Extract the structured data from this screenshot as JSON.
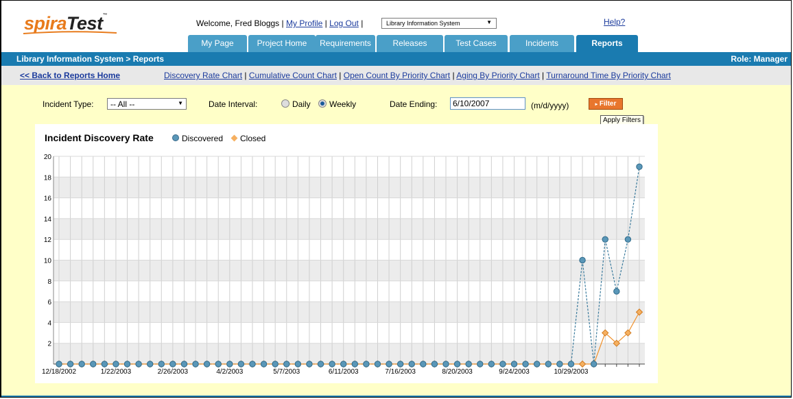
{
  "header": {
    "welcome": "Welcome, Fred Bloggs",
    "sep": "|",
    "my_profile": "My Profile",
    "log_out": "Log Out",
    "project": "Library Information System",
    "help": "Help?"
  },
  "tabs": [
    {
      "label": "My Page"
    },
    {
      "label": "Project Home"
    },
    {
      "label": "Requirements"
    },
    {
      "label": "Releases"
    },
    {
      "label": "Test Cases"
    },
    {
      "label": "Incidents"
    },
    {
      "label": "Reports",
      "active": true
    }
  ],
  "navbar": {
    "breadcrumb": "Library Information System > Reports",
    "role": "Role: Manager"
  },
  "subnav": {
    "back": "<< Back to Reports Home",
    "links": [
      "Discovery Rate Chart",
      "Cumulative Count Chart",
      "Open Count By Priority Chart",
      "Aging By Priority Chart",
      "Turnaround Time By Priority Chart"
    ]
  },
  "filters": {
    "incident_type_label": "Incident Type:",
    "incident_type_value": "-- All --",
    "date_interval_label": "Date Interval:",
    "daily": "Daily",
    "weekly": "Weekly",
    "interval_selected": "weekly",
    "date_ending_label": "Date Ending:",
    "date_ending_value": "6/10/2007",
    "date_format": "(m/d/yyyy)",
    "filter_button": "Filter",
    "tooltip": "Apply Filters"
  },
  "colors": {
    "brand_orange": "#e87b1c",
    "nav_blue": "#1a7bb0",
    "discovered": "#5a97b8",
    "closed": "#f0a050"
  },
  "chart_data": {
    "type": "line",
    "title": "Incident Discovery Rate",
    "legend_placement": "top",
    "ylim": [
      0,
      20
    ],
    "y_ticks": [
      2,
      4,
      6,
      8,
      10,
      12,
      14,
      16,
      18,
      20
    ],
    "x_tick_labels": [
      "12/18/2002",
      "1/22/2003",
      "2/26/2003",
      "4/2/2003",
      "5/7/2003",
      "6/11/2003",
      "7/16/2003",
      "8/20/2003",
      "9/24/2003",
      "10/29/2003"
    ],
    "grid": true,
    "series": [
      {
        "name": "Discovered",
        "marker": "circle",
        "values": [
          0,
          0,
          0,
          0,
          0,
          0,
          0,
          0,
          0,
          0,
          0,
          0,
          0,
          0,
          0,
          0,
          0,
          0,
          0,
          0,
          0,
          0,
          0,
          0,
          0,
          0,
          0,
          0,
          0,
          0,
          0,
          0,
          0,
          0,
          0,
          0,
          0,
          0,
          0,
          0,
          0,
          0,
          0,
          0,
          0,
          0,
          10,
          0,
          12,
          7,
          12,
          19
        ]
      },
      {
        "name": "Closed",
        "marker": "diamond",
        "values": [
          0,
          0,
          0,
          0,
          0,
          0,
          0,
          0,
          0,
          0,
          0,
          0,
          0,
          0,
          0,
          0,
          0,
          0,
          0,
          0,
          0,
          0,
          0,
          0,
          0,
          0,
          0,
          0,
          0,
          0,
          0,
          0,
          0,
          0,
          0,
          0,
          0,
          0,
          0,
          0,
          0,
          0,
          0,
          0,
          0,
          0,
          0,
          0,
          3,
          2,
          3,
          5
        ]
      }
    ]
  }
}
